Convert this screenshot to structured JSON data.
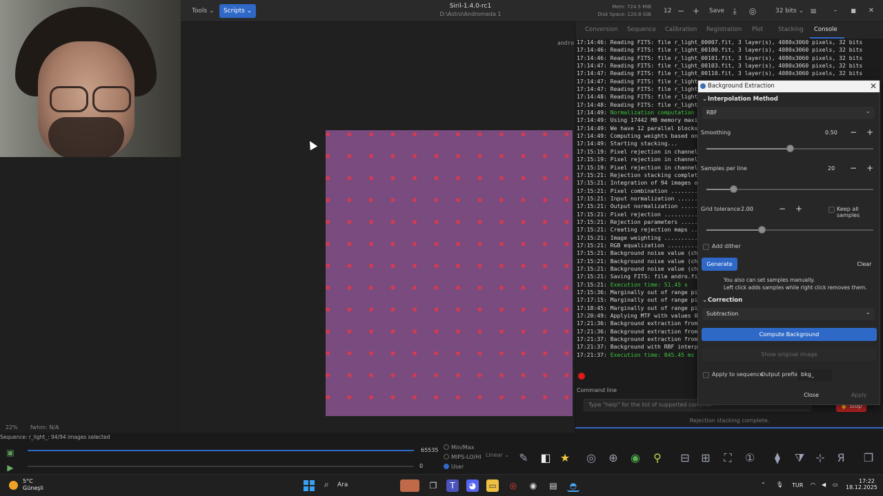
{
  "header": {
    "tools_label": "Tools",
    "scripts_label": "Scripts",
    "title": "Siril-1.4.0-rc1",
    "path": "D:\\Astro\\Andromeda 1",
    "mem": "Mem: 724.5 MiB",
    "disk": "Disk Space: 120.8 GiB",
    "threads": "12",
    "save_label": "Save",
    "bits_label": "32 bits"
  },
  "tabs": [
    "Conversion",
    "Sequence",
    "Calibration",
    "Registration",
    "Plot",
    "Stacking",
    "Console"
  ],
  "active_tab": "Console",
  "canvas": {
    "andro_label": "andro",
    "zoom": "22%",
    "fwhm": "fwhm: N/A"
  },
  "console_lines": [
    {
      "t": "17:14:46:",
      "m": "Reading FITS: file r_light_00007.fit, 3 layer(s), 4080x3060 pixels, 32 bits",
      "c": ""
    },
    {
      "t": "17:14:46:",
      "m": "Reading FITS: file r_light_00100.fit, 3 layer(s), 4080x3060 pixels, 32 bits",
      "c": ""
    },
    {
      "t": "17:14:46:",
      "m": "Reading FITS: file r_light_00101.fit, 3 layer(s), 4080x3060 pixels, 32 bits",
      "c": ""
    },
    {
      "t": "17:14:47:",
      "m": "Reading FITS: file r_light_00103.fit, 3 layer(s), 4080x3060 pixels, 32 bits",
      "c": ""
    },
    {
      "t": "17:14:47:",
      "m": "Reading FITS: file r_light_00110.fit, 3 layer(s), 4080x3060 pixels, 32 bits",
      "c": ""
    },
    {
      "t": "17:14:47:",
      "m": "Reading FITS: file r_light_",
      "c": ""
    },
    {
      "t": "17:14:47:",
      "m": "Reading FITS: file r_light_",
      "c": ""
    },
    {
      "t": "17:14:48:",
      "m": "Reading FITS: file r_light_",
      "c": ""
    },
    {
      "t": "17:14:48:",
      "m": "Reading FITS: file r_light_(",
      "c": ""
    },
    {
      "t": "17:14:49:",
      "m": "Normalization computation ti",
      "c": "green"
    },
    {
      "t": "17:14:49:",
      "m": "Using 17442 MB memory maximu",
      "c": ""
    },
    {
      "t": "17:14:49:",
      "m": "We have 12 parallel blocks o",
      "c": ""
    },
    {
      "t": "17:14:49:",
      "m": "Computing weights based on w",
      "c": ""
    },
    {
      "t": "17:14:49:",
      "m": "Starting stacking...",
      "c": ""
    },
    {
      "t": "17:15:19:",
      "m": "Pixel rejection in channel #",
      "c": ""
    },
    {
      "t": "17:15:19:",
      "m": "Pixel rejection in channel #",
      "c": ""
    },
    {
      "t": "17:15:19:",
      "m": "Pixel rejection in channel #",
      "c": ""
    },
    {
      "t": "17:15:21:",
      "m": "Rejection stacking complete.",
      "c": ""
    },
    {
      "t": "17:15:21:",
      "m": "Integration of 94 images on",
      "c": ""
    },
    {
      "t": "17:15:21:",
      "m": "Pixel combination .........",
      "c": ""
    },
    {
      "t": "17:15:21:",
      "m": "Input normalization .......",
      "c": ""
    },
    {
      "t": "17:15:21:",
      "m": "Output normalization ......",
      "c": ""
    },
    {
      "t": "17:15:21:",
      "m": "Pixel rejection ...........",
      "c": ""
    },
    {
      "t": "17:15:21:",
      "m": "Rejection parameters ......",
      "c": ""
    },
    {
      "t": "17:15:21:",
      "m": "Creating rejection maps ...",
      "c": ""
    },
    {
      "t": "17:15:21:",
      "m": "Image weighting ...........",
      "c": ""
    },
    {
      "t": "17:15:21:",
      "m": "RGB equalization ..........",
      "c": ""
    },
    {
      "t": "17:15:21:",
      "m": "Background noise value (char",
      "c": ""
    },
    {
      "t": "17:15:21:",
      "m": "Background noise value (char",
      "c": ""
    },
    {
      "t": "17:15:21:",
      "m": "Background noise value (char",
      "c": ""
    },
    {
      "t": "17:15:21:",
      "m": "Saving FITS: file andro.fit",
      "c": ""
    },
    {
      "t": "17:15:21:",
      "m": "Execution time: 51.45 s",
      "c": "green"
    },
    {
      "t": "17:15:36:",
      "m": "Marginally out of range pixe",
      "c": ""
    },
    {
      "t": "17:17:15:",
      "m": "Marginally out of range pixe",
      "c": ""
    },
    {
      "t": "17:18:45:",
      "m": "Marginally out of range pixe",
      "c": ""
    },
    {
      "t": "17:20:49:",
      "m": "Applying MTF with values 0.0",
      "c": ""
    },
    {
      "t": "17:21:36:",
      "m": "Background extraction from r",
      "c": ""
    },
    {
      "t": "17:21:36:",
      "m": "Background extraction from g",
      "c": ""
    },
    {
      "t": "17:21:37:",
      "m": "Background extraction from b",
      "c": ""
    },
    {
      "t": "17:21:37:",
      "m": "Background with RBF interpol",
      "c": ""
    },
    {
      "t": "17:21:37:",
      "m": "Execution time: 845.45 ms",
      "c": "green"
    }
  ],
  "command_line": {
    "label": "Command line",
    "placeholder": "Type \"help\" for the list of supported comman",
    "stop_label": "Stop",
    "status": "Rejection stacking complete."
  },
  "dialog": {
    "title": "Background Extraction",
    "interp_header": "Interpolation Method",
    "interp_value": "RBF",
    "smoothing_label": "Smoothing",
    "smoothing_value": "0.50",
    "smoothing_level": 0.5,
    "samples_label": "Samples per line",
    "samples_value": "20",
    "samples_level": 0.16,
    "grid_label": "Grid tolerance",
    "grid_value": "2.00",
    "grid_level": 0.33,
    "keep_all_label": "Keep all samples",
    "add_dither_label": "Add dither",
    "generate_label": "Generate",
    "clear_label": "Clear",
    "hint1": "You also can set samples manually.",
    "hint2": "Left click adds samples while right click removes them.",
    "correction_header": "Correction",
    "correction_value": "Subtraction",
    "compute_label": "Compute Background",
    "show_original_label": "Show original image",
    "apply_seq_label": "Apply to sequence",
    "output_prefix_label": "Output prefix:",
    "output_prefix_value": "bkg_",
    "close_label": "Close",
    "apply_label": "Apply"
  },
  "bottom": {
    "sequence_text": "Sequence: r_light_: 94/94 images selected",
    "hist_max": "65535",
    "hist_min": "0",
    "radio_minmax": "Min/Max",
    "radio_mips": "MIPS-LO/HI",
    "radio_user": "User",
    "scale_mode": "Linear"
  },
  "taskbar": {
    "temp": "5°C",
    "weather": "Güneşli",
    "search": "Ara",
    "lang": "TUR",
    "time": "17:22",
    "date": "18.12.2025"
  },
  "colors": {
    "accent": "#2f69c7",
    "image_bg": "#7a4b7e",
    "sample_dot": "#e03a4a",
    "console_green": "#3ec43e"
  }
}
